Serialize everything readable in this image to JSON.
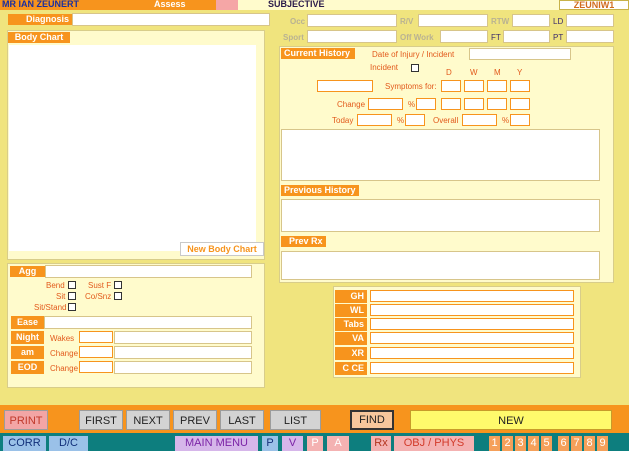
{
  "header": {
    "patient_name": "MR IAN ZEUNERT",
    "assess_tab": "Assess",
    "subjective_tab": "SUBJECTIVE",
    "patient_code": "ZEUNIW1"
  },
  "left_panel": {
    "diagnosis_label": "Diagnosis",
    "body_chart_label": "Body Chart",
    "new_body_chart_button": "New Body Chart"
  },
  "top_fields": {
    "occ": "Occ",
    "rv": "R/V",
    "rtw": "RTW",
    "ld": "LD",
    "sport": "Sport",
    "off_work": "Off Work",
    "ft": "FT",
    "pt": "PT"
  },
  "current_history": {
    "title": "Current History",
    "date_label": "Date of Injury / Incident",
    "incident_label": "Incident",
    "cols": [
      "D",
      "W",
      "M",
      "Y"
    ],
    "symptoms_label": "Symptoms for:",
    "change_label": "Change",
    "today_label": "Today",
    "overall_label": "Overall",
    "percent": "%"
  },
  "previous_history": {
    "title": "Previous History"
  },
  "prev_rx": {
    "title": "Prev Rx"
  },
  "agg": {
    "label": "Agg",
    "checks": [
      "Bend",
      "Sust F",
      "Sit",
      "Co/Snz",
      "Sit/Stand"
    ]
  },
  "lower_left": {
    "ease": "Ease",
    "night": "Night",
    "wakes": "Wakes",
    "am": "am",
    "change": "Change",
    "eod": "EOD"
  },
  "history_fields": [
    "GH",
    "WL",
    "Tabs",
    "VA",
    "XR",
    "C CE"
  ],
  "toolbar": {
    "print": "PRINT",
    "first": "FIRST",
    "next": "NEXT",
    "prev": "PREV",
    "last": "LAST",
    "list": "LIST",
    "find": "FIND",
    "new": "NEW"
  },
  "navbar": {
    "corr": "CORR",
    "dc": "D/C",
    "main_menu": "MAIN MENU",
    "p": "P",
    "v": "V",
    "p2": "P",
    "a": "A",
    "rx": "Rx",
    "obj_phys": "OBJ / PHYS",
    "nums": [
      "1",
      "2",
      "3",
      "4",
      "5",
      "6",
      "7",
      "8",
      "9"
    ]
  }
}
